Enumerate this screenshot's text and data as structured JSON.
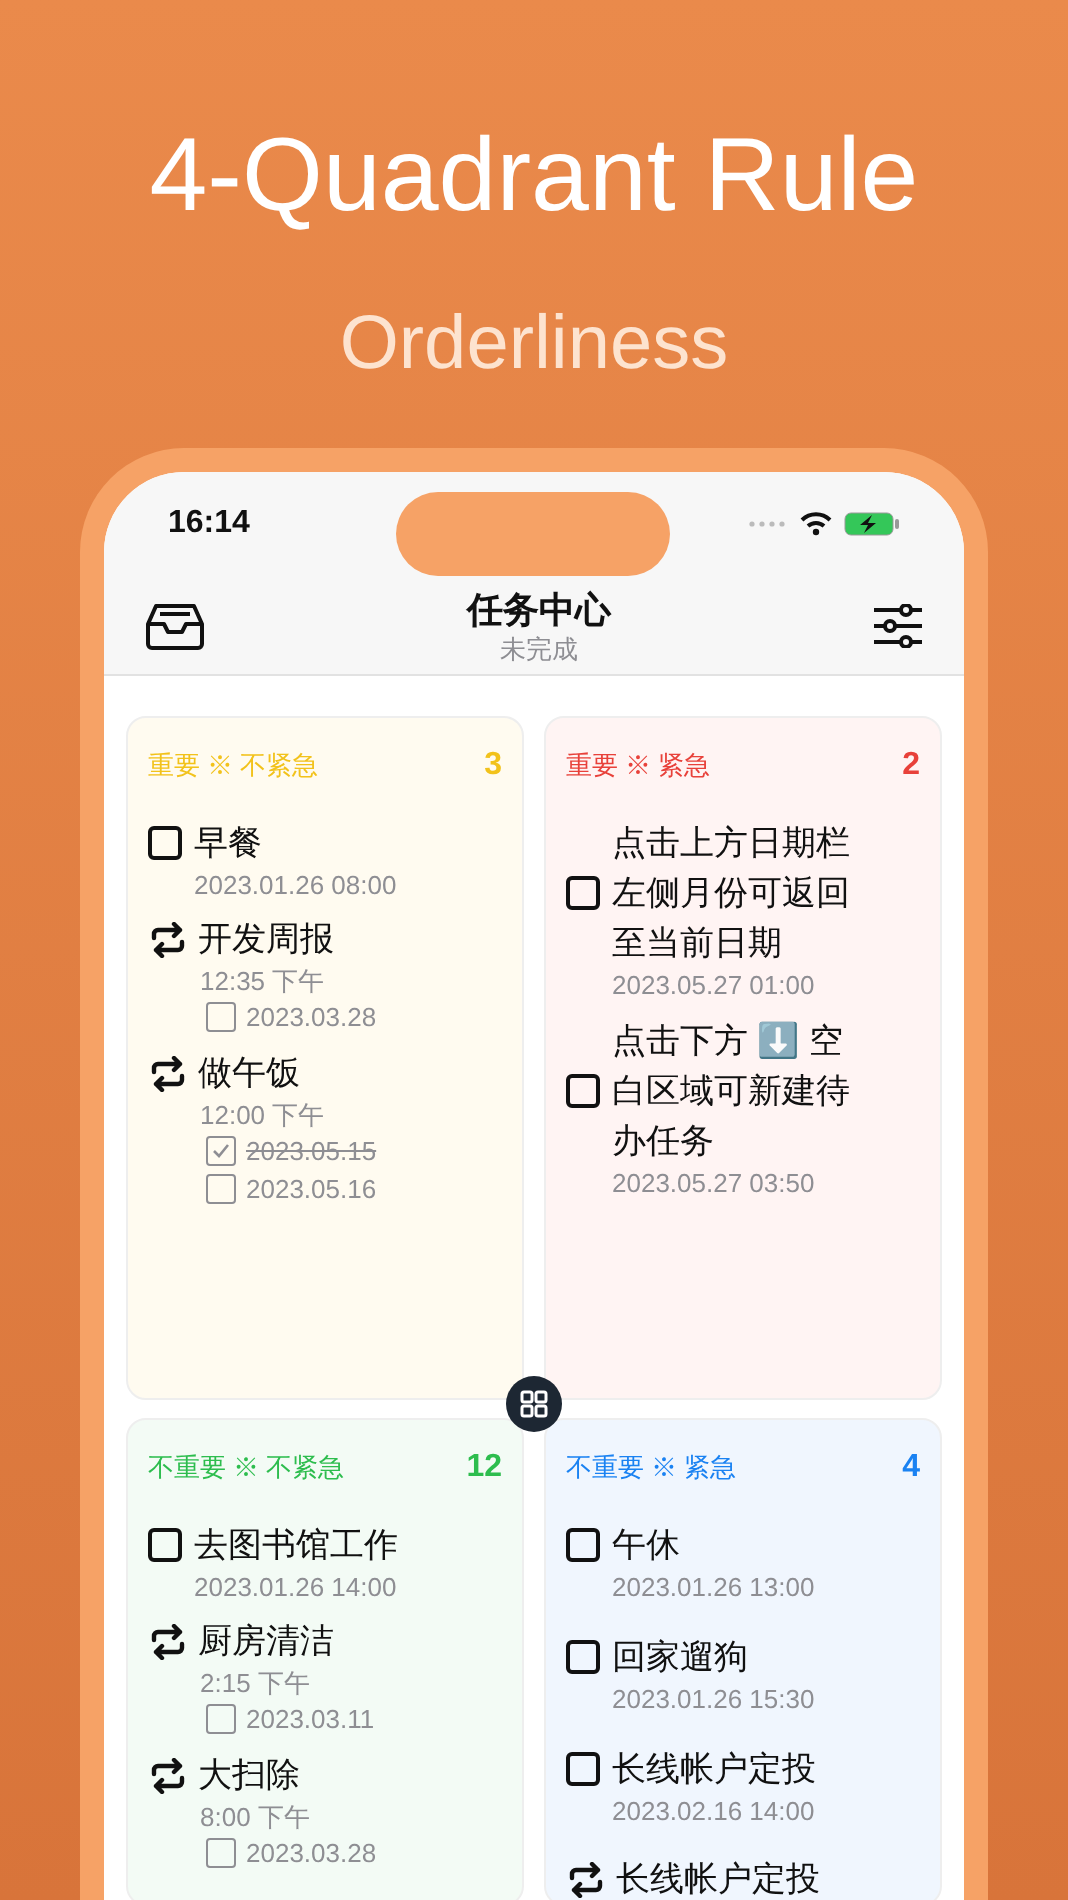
{
  "headline": "4-Quadrant Rule",
  "subtitle": "Orderliness",
  "status_bar": {
    "time": "16:14"
  },
  "nav": {
    "title": "任务中心",
    "subtitle": "未完成"
  },
  "quadrants": [
    {
      "title": "重要 ※ 不紧急",
      "count": "3",
      "color": "#f2c21b",
      "items": [
        {
          "kind": "task",
          "checked": false,
          "title": "早餐",
          "date": "2023.01.26 08:00"
        },
        {
          "kind": "repeat",
          "title": "开发周报",
          "time": "12:35 下午",
          "occurrences": [
            {
              "checked": false,
              "date": "2023.03.28"
            }
          ]
        },
        {
          "kind": "repeat",
          "title": "做午饭",
          "time": "12:00 下午",
          "occurrences": [
            {
              "checked": true,
              "date": "2023.05.15"
            },
            {
              "checked": false,
              "date": "2023.05.16"
            }
          ]
        }
      ]
    },
    {
      "title": "重要 ※ 紧急",
      "count": "2",
      "color": "#e8413a",
      "items": [
        {
          "kind": "task",
          "checked": false,
          "title": "点击上方日期栏左侧月份可返回至当前日期",
          "date": "2023.05.27 01:00"
        },
        {
          "kind": "task",
          "checked": false,
          "title": "点击下方 ⬇️ 空白区域可新建待办任务",
          "date": "2023.05.27 03:50"
        }
      ]
    },
    {
      "title": "不重要 ※ 不紧急",
      "count": "12",
      "color": "#2dbd4e",
      "items": [
        {
          "kind": "task",
          "checked": false,
          "title": "去图书馆工作",
          "date": "2023.01.26 14:00"
        },
        {
          "kind": "repeat",
          "title": "厨房清洁",
          "time": "2:15 下午",
          "occurrences": [
            {
              "checked": false,
              "date": "2023.03.11"
            }
          ]
        },
        {
          "kind": "repeat",
          "title": "大扫除",
          "time": "8:00 下午",
          "occurrences": [
            {
              "checked": false,
              "date": "2023.03.28"
            }
          ]
        }
      ]
    },
    {
      "title": "不重要 ※ 紧急",
      "count": "4",
      "color": "#1a82f2",
      "items": [
        {
          "kind": "task",
          "checked": false,
          "title": "午休",
          "date": "2023.01.26 13:00"
        },
        {
          "kind": "task",
          "checked": false,
          "title": "回家遛狗",
          "date": "2023.01.26 15:30"
        },
        {
          "kind": "task",
          "checked": false,
          "title": "长线帐户定投",
          "date": "2023.02.16 14:00"
        },
        {
          "kind": "repeat",
          "title": "长线帐户定投"
        }
      ]
    }
  ]
}
